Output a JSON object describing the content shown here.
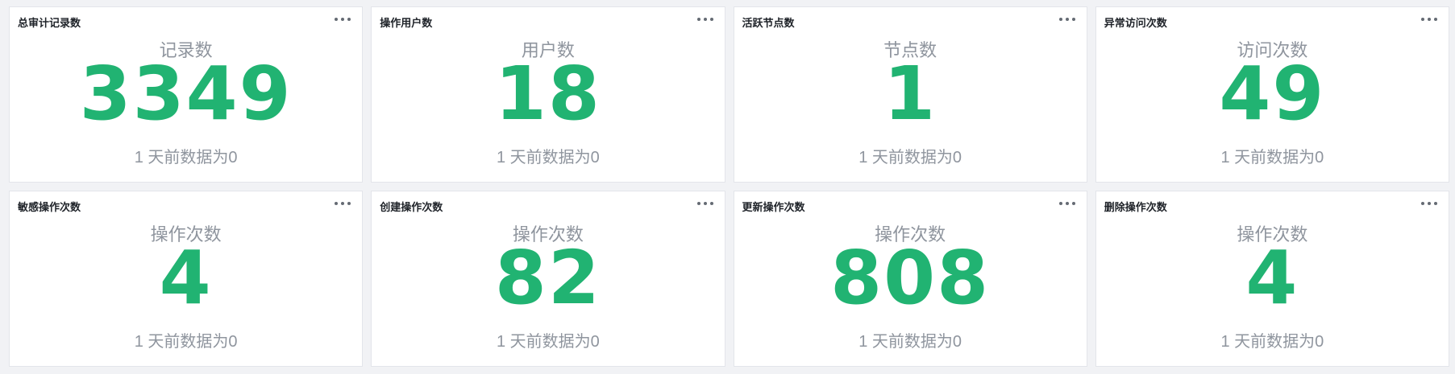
{
  "cards": [
    {
      "title": "总审计记录数",
      "label": "记录数",
      "value": "3349",
      "compare": "1 天前数据为0"
    },
    {
      "title": "操作用户数",
      "label": "用户数",
      "value": "18",
      "compare": "1 天前数据为0"
    },
    {
      "title": "活跃节点数",
      "label": "节点数",
      "value": "1",
      "compare": "1 天前数据为0"
    },
    {
      "title": "异常访问次数",
      "label": "访问次数",
      "value": "49",
      "compare": "1 天前数据为0"
    },
    {
      "title": "敏感操作次数",
      "label": "操作次数",
      "value": "4",
      "compare": "1 天前数据为0"
    },
    {
      "title": "创建操作次数",
      "label": "操作次数",
      "value": "82",
      "compare": "1 天前数据为0"
    },
    {
      "title": "更新操作次数",
      "label": "操作次数",
      "value": "808",
      "compare": "1 天前数据为0"
    },
    {
      "title": "删除操作次数",
      "label": "操作次数",
      "value": "4",
      "compare": "1 天前数据为0"
    }
  ],
  "icons": {
    "more": "more-horizontal-icon"
  },
  "colors": {
    "value": "#21b372",
    "label": "#8f959e",
    "title": "#1f2329",
    "background": "#f1f2f5"
  }
}
